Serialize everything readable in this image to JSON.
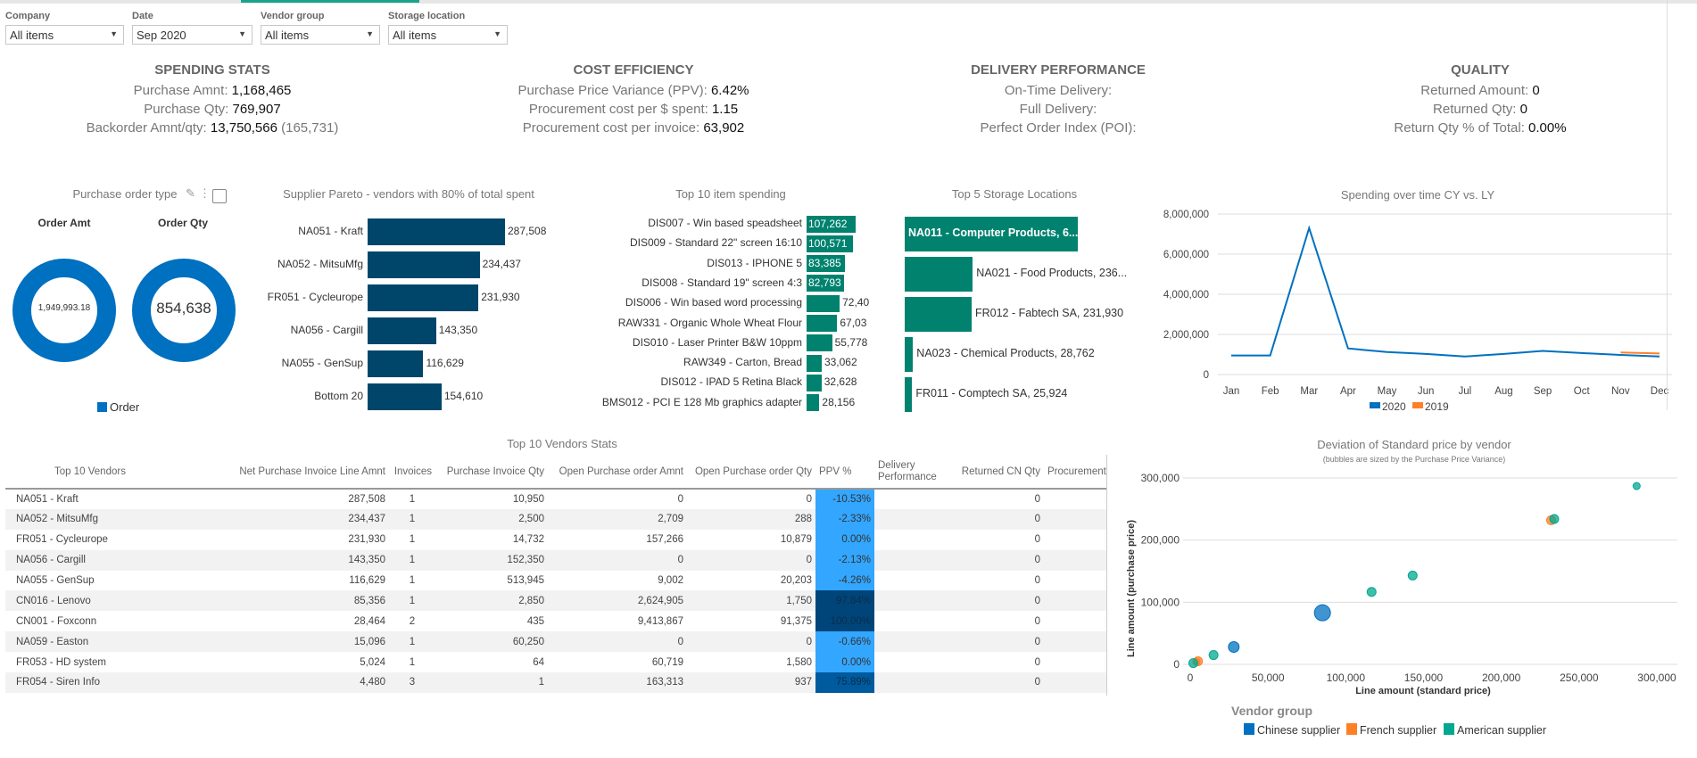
{
  "filters": [
    {
      "label": "Company",
      "value": "All items"
    },
    {
      "label": "Date",
      "value": "Sep 2020"
    },
    {
      "label": "Vendor group",
      "value": "All items"
    },
    {
      "label": "Storage location",
      "value": "All items"
    }
  ],
  "stats": {
    "spending": {
      "title": "SPENDING STATS",
      "lines": [
        {
          "label": "Purchase Amnt: ",
          "value": "1,168,465"
        },
        {
          "label": "Purchase Qty: ",
          "value": "769,907"
        },
        {
          "label": "Backorder Amnt/qty: ",
          "value": "13,750,566",
          "extra": " (165,731)"
        }
      ]
    },
    "cost": {
      "title": "COST EFFICIENCY",
      "lines": [
        {
          "label": "Purchase Price Variance (PPV): ",
          "value": "6.42%"
        },
        {
          "label": "Procurement cost per $ spent: ",
          "value": "1.15"
        },
        {
          "label": "Procurement cost per invoice: ",
          "value": "63,902"
        }
      ]
    },
    "delivery": {
      "title": "DELIVERY PERFORMANCE",
      "lines": [
        {
          "label": "On-Time Delivery:",
          "value": ""
        },
        {
          "label": "Full Delivery:",
          "value": ""
        },
        {
          "label": "Perfect Order Index (POI):",
          "value": ""
        }
      ]
    },
    "quality": {
      "title": "QUALITY",
      "lines": [
        {
          "label": "Returned Amount: ",
          "value": "0"
        },
        {
          "label": "Returned Qty: ",
          "value": "0"
        },
        {
          "label": "Return Qty % of Total: ",
          "value": "0.00%"
        }
      ]
    }
  },
  "po_type": {
    "title": "Purchase order type",
    "amt_label": "Order Amt",
    "qty_label": "Order Qty",
    "amt_value": "1,949,993.18",
    "qty_value": "854,638",
    "legend": "Order",
    "color": "#0070c0"
  },
  "chart_data": [
    {
      "type": "bar",
      "orientation": "horizontal",
      "title": "Supplier Pareto - vendors with 80% of total spent",
      "color": "#00466b",
      "categories": [
        "NA051 - Kraft",
        "NA052 - MitsuMfg",
        "FR051 - Cycleurope",
        "NA056 - Cargill",
        "NA055 - GenSup",
        "Bottom 20"
      ],
      "values": [
        287508,
        234437,
        231930,
        143350,
        116629,
        154610
      ],
      "labels": [
        "287,508",
        "234,437",
        "231,930",
        "143,350",
        "116,629",
        "154,610"
      ]
    },
    {
      "type": "bar",
      "orientation": "horizontal",
      "title": "Top 10 item spending",
      "color": "#00826f",
      "categories": [
        "DIS007 - Win based speadsheet",
        "DIS009 - Standard 22\" screen 16:10",
        "DIS013 - IPHONE 5",
        "DIS008 - Standard 19\" screen 4:3",
        "DIS006 - Win based word processing",
        "RAW331 - Organic Whole Wheat Flour",
        "DIS010 - Laser Printer B&W 10ppm",
        "RAW349 - Carton, Bread",
        "DIS012 - IPAD 5 Retina Black",
        "BMS012 - PCI E 128 Mb graphics adapter"
      ],
      "values": [
        107262,
        100571,
        83385,
        82793,
        72400,
        67030,
        55778,
        33062,
        32628,
        28156
      ],
      "labels": [
        "107,262",
        "100,571",
        "83,385",
        "82,793",
        "72,40",
        "67,03",
        "55,778",
        "33,062",
        "32,628",
        "28,156"
      ]
    },
    {
      "type": "bar",
      "orientation": "horizontal",
      "title": "Top 5 Storage Locations",
      "color": "#00826f",
      "categories": [
        "NA011 - Computer Products, 6...",
        "NA021 - Food Products, 236...",
        "FR012 - Fabtech SA, 231,930",
        "NA023 - Chemical Products, 28,762",
        "FR011 - Comptech SA, 25,924"
      ],
      "values": [
        600000,
        236000,
        231930,
        28762,
        25924
      ]
    },
    {
      "type": "line",
      "title": "Spending over time CY vs. LY",
      "x": [
        "Jan",
        "Feb",
        "Mar",
        "Apr",
        "May",
        "Jun",
        "Jul",
        "Aug",
        "Sep",
        "Oct",
        "Nov",
        "Dec"
      ],
      "ylim": [
        0,
        8000000
      ],
      "yticks": [
        "0",
        "2,000,000",
        "4,000,000",
        "6,000,000",
        "8,000,000"
      ],
      "grid": true,
      "legend": "bottom",
      "series": [
        {
          "name": "2020",
          "color": "#0070c0",
          "values": [
            950000,
            950000,
            7300000,
            1300000,
            1120000,
            1030000,
            900000,
            1030000,
            1180000,
            1070000,
            980000,
            900000
          ]
        },
        {
          "name": "2019",
          "color": "#ff7f27",
          "values": [
            null,
            null,
            null,
            null,
            null,
            null,
            null,
            null,
            null,
            null,
            1100000,
            1050000
          ]
        }
      ]
    },
    {
      "type": "scatter",
      "title": "Deviation of Standard price by vendor",
      "subtitle": "(bubbles are sized by the Purchase Price Variance)",
      "xlabel": "Line amount (standard price)",
      "ylabel": "Line amount (purchase price)",
      "xlim": [
        0,
        300000
      ],
      "ylim": [
        0,
        300000
      ],
      "xticks": [
        "0",
        "50,000",
        "100,000",
        "150,000",
        "200,000",
        "250,000",
        "300,000"
      ],
      "yticks": [
        "0",
        "100,000",
        "200,000",
        "300,000"
      ],
      "legend_title": "Vendor group",
      "grid": true,
      "series": [
        {
          "name": "Chinese supplier",
          "color": "#0070c0",
          "points": [
            [
              85000,
              83000,
              9
            ],
            [
              28000,
              28000,
              6
            ]
          ]
        },
        {
          "name": "French supplier",
          "color": "#ff7f27",
          "points": [
            [
              232000,
              232000,
              5
            ],
            [
              5000,
              5000,
              5
            ],
            [
              4000,
              4000,
              4
            ]
          ]
        },
        {
          "name": "American supplier",
          "color": "#00a88f",
          "points": [
            [
              287000,
              287000,
              4
            ],
            [
              234000,
              234000,
              5
            ],
            [
              143000,
              143000,
              5
            ],
            [
              116600,
              116600,
              5
            ],
            [
              15000,
              15000,
              5
            ],
            [
              2000,
              2000,
              5
            ]
          ]
        }
      ]
    }
  ],
  "table": {
    "title": "Top 10 Vendors Stats",
    "headers": [
      "Top 10 Vendors",
      "Net Purchase Invoice Line Amnt",
      "Invoices",
      "Purchase Invoice Qty",
      "Open Purchase order Amnt",
      "Open Purchase order Qty",
      "PPV %",
      "Delivery Performance",
      "Returned CN Qty",
      "Procurement c"
    ],
    "rows": [
      [
        "NA051 - Kraft",
        "287,508",
        "1",
        "10,950",
        "0",
        "0",
        "-10.53%",
        "",
        "0"
      ],
      [
        "NA052 - MitsuMfg",
        "234,437",
        "1",
        "2,500",
        "2,709",
        "288",
        "-2.33%",
        "",
        "0"
      ],
      [
        "FR051 - Cycleurope",
        "231,930",
        "1",
        "14,732",
        "157,266",
        "10,879",
        "0.00%",
        "",
        "0"
      ],
      [
        "NA056 - Cargill",
        "143,350",
        "1",
        "152,350",
        "0",
        "0",
        "-2.13%",
        "",
        "0"
      ],
      [
        "NA055 - GenSup",
        "116,629",
        "1",
        "513,945",
        "9,002",
        "20,203",
        "-4.26%",
        "",
        "0"
      ],
      [
        "CN016 - Lenovo",
        "85,356",
        "1",
        "2,850",
        "2,624,905",
        "1,750",
        "97.84%",
        "",
        "0"
      ],
      [
        "CN001 - Foxconn",
        "28,464",
        "2",
        "435",
        "9,413,867",
        "91,375",
        "100.00%",
        "",
        "0"
      ],
      [
        "NA059 - Easton",
        "15,096",
        "1",
        "60,250",
        "0",
        "0",
        "-0.66%",
        "",
        "0"
      ],
      [
        "FR053 - HD system",
        "5,024",
        "1",
        "64",
        "60,719",
        "1,580",
        "0.00%",
        "",
        "0"
      ],
      [
        "FR054 - Siren Info",
        "4,480",
        "3",
        "1",
        "163,313",
        "937",
        "75.89%",
        "",
        "0"
      ]
    ]
  }
}
